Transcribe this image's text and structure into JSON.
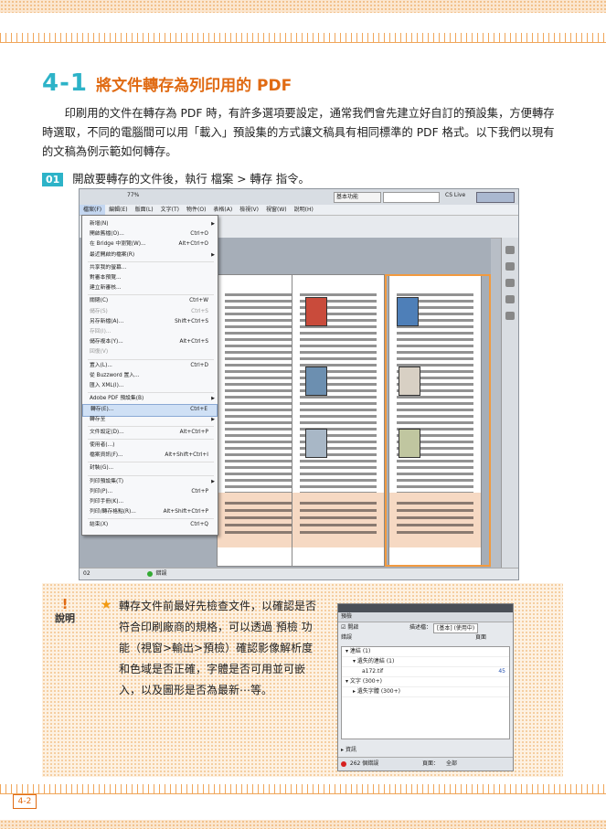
{
  "section": {
    "number": "4-1",
    "title": "將文件轉存為列印用的 PDF"
  },
  "intro": "印刷用的文件在轉存為 PDF 時，有許多選項要設定，通常我們會先建立好自訂的預設集，方便轉存時選取，不同的電腦間可以用「載入」預設集的方式讓文稿具有相同標準的 PDF 格式。以下我們以現有的文稿為例示範如何轉存。",
  "step": {
    "badge": "01",
    "text": "開啟要轉存的文件後，執行 檔案 > 轉存 指令。"
  },
  "app": {
    "zoom": "77%",
    "workspace": "基本功能",
    "cs_live": "CS Live",
    "menubar": [
      "檔案(F)",
      "編輯(E)",
      "版面(L)",
      "文字(T)",
      "物件(O)",
      "表格(A)",
      "檢視(V)",
      "視窗(W)",
      "說明(H)"
    ],
    "file_menu": [
      {
        "label": "新增(N)",
        "shortcut": "",
        "submenu": true
      },
      {
        "label": "開啟舊檔(O)...",
        "shortcut": "Ctrl+O"
      },
      {
        "label": "在 Bridge 中瀏覽(W)...",
        "shortcut": "Alt+Ctrl+O"
      },
      {
        "label": "最近開啟的檔案(R)",
        "shortcut": "",
        "submenu": true
      },
      {
        "label": "共享我的螢幕...",
        "shortcut": ""
      },
      {
        "label": "對審本預覽...",
        "shortcut": ""
      },
      {
        "label": "建立新審核...",
        "shortcut": ""
      },
      {
        "label": "關閉(C)",
        "shortcut": "Ctrl+W"
      },
      {
        "label": "儲存(S)",
        "shortcut": "Ctrl+S",
        "disabled": true
      },
      {
        "label": "另存新檔(A)...",
        "shortcut": "Shift+Ctrl+S"
      },
      {
        "label": "存回(I)...",
        "shortcut": "",
        "disabled": true
      },
      {
        "label": "儲存複本(Y)...",
        "shortcut": "Alt+Ctrl+S"
      },
      {
        "label": "回復(V)",
        "shortcut": "",
        "disabled": true
      },
      {
        "label": "置入(L)...",
        "shortcut": "Ctrl+D"
      },
      {
        "label": "從 Buzzword 置入...",
        "shortcut": ""
      },
      {
        "label": "匯入 XML(I)...",
        "shortcut": ""
      },
      {
        "label": "Adobe PDF 預設集(B)",
        "shortcut": "",
        "submenu": true
      },
      {
        "label": "轉存(E)...",
        "shortcut": "Ctrl+E",
        "selected": true
      },
      {
        "label": "轉存至",
        "shortcut": "",
        "submenu": true
      },
      {
        "label": "文件設定(D)...",
        "shortcut": "Alt+Ctrl+P"
      },
      {
        "label": "使用者(...)",
        "shortcut": ""
      },
      {
        "label": "檔案資訊(F)...",
        "shortcut": "Alt+Shift+Ctrl+I"
      },
      {
        "label": "封裝(G)...",
        "shortcut": ""
      },
      {
        "label": "列印預設集(T)",
        "shortcut": "",
        "submenu": true
      },
      {
        "label": "列印(P)...",
        "shortcut": "Ctrl+P"
      },
      {
        "label": "列印手冊(K)...",
        "shortcut": ""
      },
      {
        "label": "列印/轉存格點(R)...",
        "shortcut": "Alt+Shift+Ctrl+P"
      },
      {
        "label": "結束(X)",
        "shortcut": "Ctrl+Q"
      }
    ],
    "status": {
      "page": "02",
      "errors": "錯誤"
    }
  },
  "note": {
    "label": "說明",
    "text": "轉存文件前最好先檢查文件，以確認是否符合印刷廠商的規格，可以透過 預檢 功能（視窗>輸出>預檢）確認影像解析度和色域是否正確，字體是否可用並可嵌入，以及圖形是否為最新⋯等。"
  },
  "preflight": {
    "title": "預檢",
    "on_label": "開啟",
    "profile_label": "描述檔：",
    "profile_value": "[基本] (使用中)",
    "col_error": "錯誤",
    "col_page": "頁面",
    "items": [
      {
        "label": "連結 (1)",
        "page": ""
      },
      {
        "label": "遺失的連結 (1)",
        "page": ""
      },
      {
        "label": "a172.tif",
        "page": "45"
      },
      {
        "label": "文字 (300+)",
        "page": ""
      },
      {
        "label": "遺失字體 (300+)",
        "page": ""
      }
    ],
    "info_label": "資訊",
    "error_count": "262 個錯誤",
    "pages_label": "頁面：",
    "pages_value": "全部"
  },
  "page_number": "4-2"
}
